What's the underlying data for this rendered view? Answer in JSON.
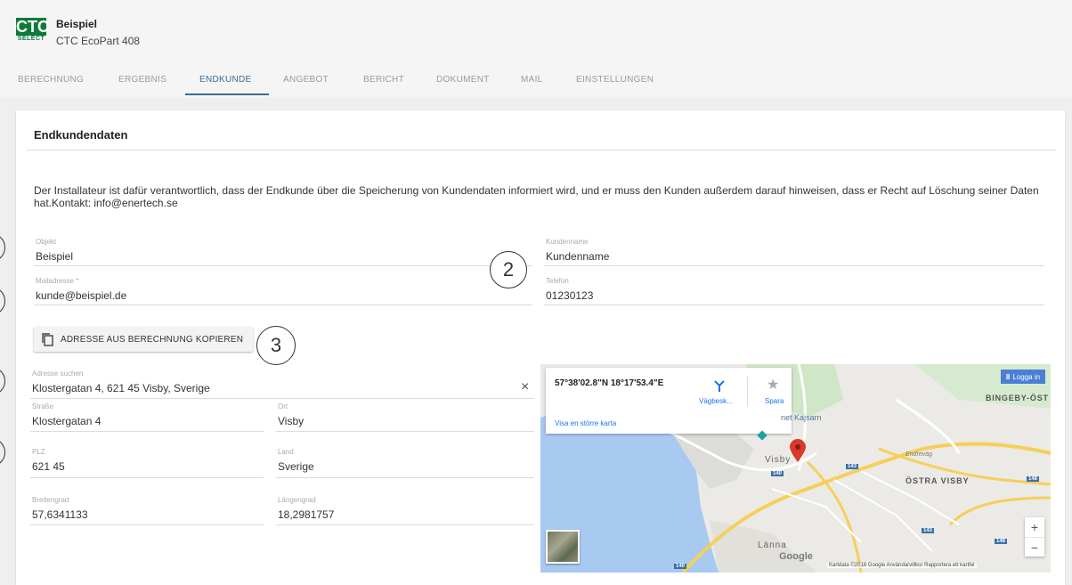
{
  "header": {
    "logo_top": "CTC",
    "logo_bottom": "SELECT",
    "title": "Beispiel",
    "subtitle": "CTC EcoPart 408"
  },
  "tabs": [
    "BERECHNUNG",
    "ERGEBNIS",
    "ENDKUNDE",
    "ANGEBOT",
    "BERICHT",
    "DOKUMENT",
    "MAIL",
    "EINSTELLUNGEN"
  ],
  "active_tab": "ENDKUNDE",
  "section": {
    "title": "Endkundendaten",
    "notice": "Der Installateur ist dafür verantwortlich, dass der Endkunde über die Speicherung von Kundendaten informiert wird, und er muss den Kunden außerdem darauf hinweisen, dass er Recht auf Löschung seiner Daten hat.Kontakt: info@enertech.se"
  },
  "fields": {
    "objekt": {
      "label": "Objekt",
      "value": "Beispiel"
    },
    "kundenname": {
      "label": "Kundenname",
      "value": "Kundenname"
    },
    "mailadresse": {
      "label": "Mailadresse *",
      "value": "kunde@beispiel.de"
    },
    "telefon": {
      "label": "Telefon",
      "value": "01230123"
    },
    "adresse_suchen": {
      "label": "Adresse suchen",
      "value": "Klostergatan 4, 621 45 Visby, Sverige",
      "clear": "×"
    },
    "strasse": {
      "label": "Straße",
      "value": "Klostergatan 4"
    },
    "ort": {
      "label": "Ort",
      "value": "Visby"
    },
    "plz": {
      "label": "PLZ",
      "value": "621 45"
    },
    "land": {
      "label": "Land",
      "value": "Sverige"
    },
    "breitengrad": {
      "label": "Breitengrad",
      "value": "57,6341133"
    },
    "laengengrad": {
      "label": "Längengrad",
      "value": "18,2981757"
    }
  },
  "copy_button": {
    "label": "ADRESSE AUS BERECHNUNG KOPIEREN"
  },
  "callouts": [
    "2",
    "3"
  ],
  "map": {
    "coords": "57°38'02.8\"N 18°17'53.4\"E",
    "directions": "Vägbesk...",
    "save": "Spara",
    "larger_map": "Visa en större karta",
    "login": "Logga in",
    "labels": {
      "bingeby": "BINGEBY-ÖST",
      "kajsarn": "net Kajsarn",
      "visby": "Visby",
      "ostra_visby": "ÖSTRA VISBY",
      "lanna": "Länna",
      "endrevag": "Endreväg"
    },
    "road_numbers": [
      "140",
      "143",
      "140",
      "148",
      "143",
      "148",
      "140"
    ],
    "google": "Google",
    "footer": "Kartdata ©2018 Google   Användarvillkor   Rapportera ett kartfel",
    "zoom_in": "+",
    "zoom_out": "−",
    "colors": {
      "water": "#a8c9f0",
      "land": "#eceae6",
      "road": "#f6cf5a",
      "pin": "#d93a2b"
    }
  }
}
